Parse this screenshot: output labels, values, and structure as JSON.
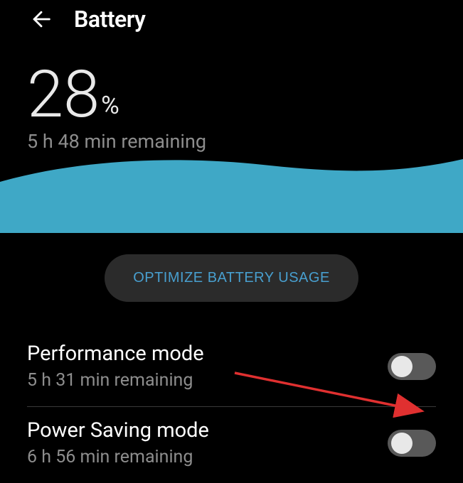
{
  "header": {
    "title": "Battery"
  },
  "battery": {
    "percent": "28",
    "percent_sign": "%",
    "remaining": "5 h 48 min remaining"
  },
  "optimize": {
    "label": "OPTIMIZE BATTERY USAGE"
  },
  "modes": {
    "performance": {
      "title": "Performance mode",
      "subtitle": "5 h 31 min remaining",
      "enabled": false
    },
    "power_saving": {
      "title": "Power Saving mode",
      "subtitle": "6 h 56 min remaining",
      "enabled": false
    }
  },
  "colors": {
    "wave": "#3fa8c6",
    "accent": "#489fcf"
  }
}
